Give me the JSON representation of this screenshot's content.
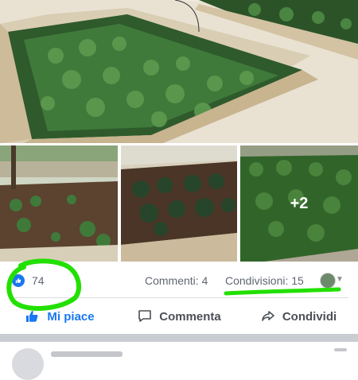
{
  "post": {
    "extra_photos_label": "+2"
  },
  "stats": {
    "likes": "74",
    "comments": "Commenti: 4",
    "shares": "Condivisioni: 15"
  },
  "actions": {
    "like_label": "Mi piace",
    "comment_label": "Commenta",
    "share_label": "Condividi"
  },
  "colors": {
    "accent": "#1877f2",
    "highlight": "#22e000",
    "muted_text": "#606770",
    "divider": "#dadde1"
  },
  "icons": {
    "like_badge": "thumbs-up-icon",
    "like_action": "thumbs-up-icon",
    "comment_action": "speech-bubble-icon",
    "share_action": "share-arrow-icon",
    "audience": "avatar-dropdown-icon"
  }
}
